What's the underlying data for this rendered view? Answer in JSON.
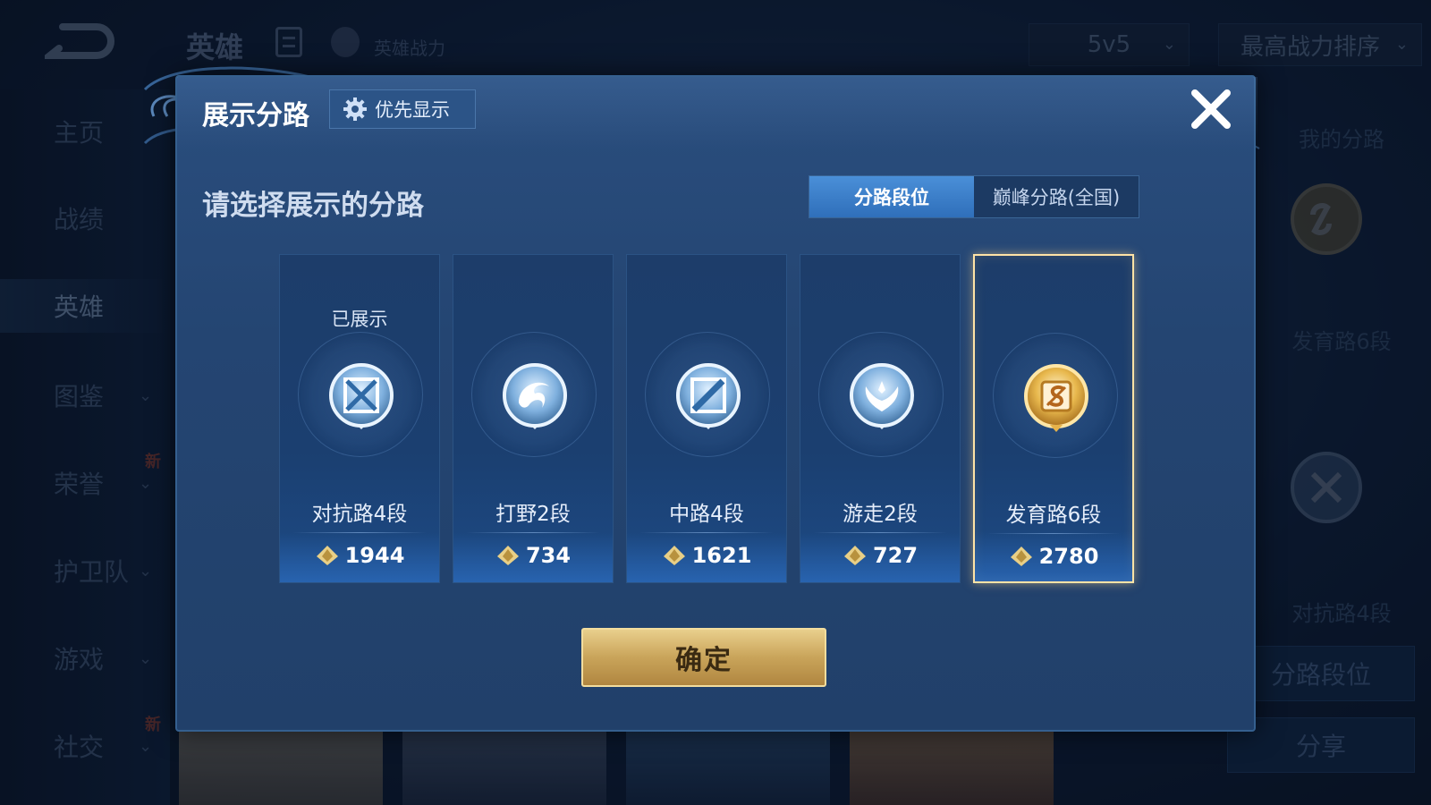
{
  "background": {
    "title": "英雄",
    "power_label": "英雄战力",
    "mode_select": "5v5",
    "sort_select": "最高战力排序",
    "nav": [
      {
        "label": "主页"
      },
      {
        "label": "战绩"
      },
      {
        "label": "英雄",
        "active": true
      },
      {
        "label": "图鉴",
        "chevron": true
      },
      {
        "label": "荣誉",
        "chevron": true,
        "new": "新"
      },
      {
        "label": "护卫队",
        "chevron": true
      },
      {
        "label": "游戏",
        "chevron": true
      },
      {
        "label": "社交",
        "chevron": true,
        "new": "新"
      }
    ],
    "right_panel": {
      "heading": "我的分路",
      "lane1": "发育路6段",
      "lane2": "对抗路4段",
      "rank_button": "分路段位",
      "share_button": "分享"
    }
  },
  "modal": {
    "title": "展示分路",
    "priority_button": "优先显示",
    "subtitle": "请选择展示的分路",
    "tabs": [
      {
        "label": "分路段位",
        "active": true
      },
      {
        "label": "巅峰分路(全国)",
        "active": false
      }
    ],
    "lanes": [
      {
        "name": "对抗路4段",
        "score": "1944",
        "badge": "已展示",
        "icon": "clash-lane-icon",
        "selected": false
      },
      {
        "name": "打野2段",
        "score": "734",
        "badge": "",
        "icon": "jungle-dragon-icon",
        "selected": false
      },
      {
        "name": "中路4段",
        "score": "1621",
        "badge": "",
        "icon": "mid-lane-icon",
        "selected": false
      },
      {
        "name": "游走2段",
        "score": "727",
        "badge": "",
        "icon": "roam-wings-icon",
        "selected": false
      },
      {
        "name": "发育路6段",
        "score": "2780",
        "badge": "",
        "icon": "farm-lane-icon",
        "selected": true
      }
    ],
    "confirm_button": "确定"
  },
  "colors": {
    "accent_gold": "#e9cf8c",
    "tab_active": "#3f82cc",
    "selected_border": "#ffe3a6"
  }
}
